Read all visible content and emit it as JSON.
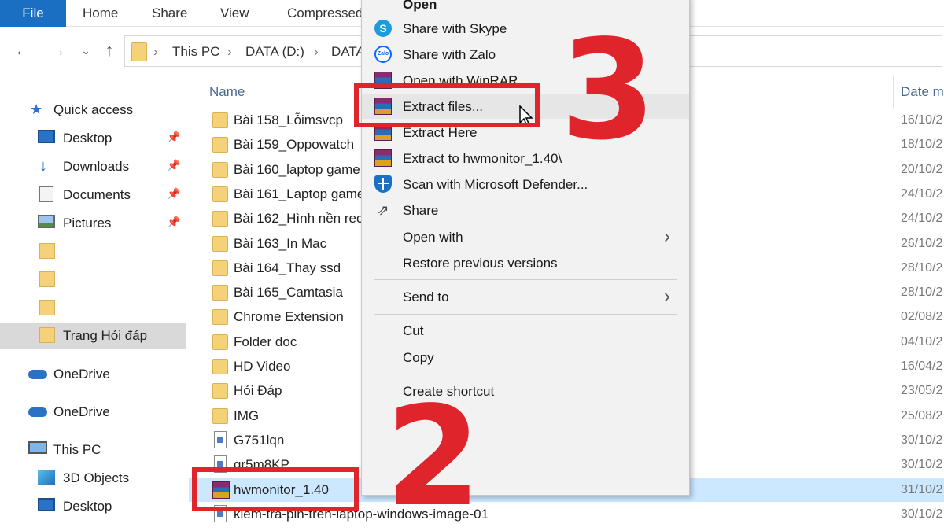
{
  "ribbon": {
    "tabs": [
      "File",
      "Home",
      "Share",
      "View",
      "Compressed"
    ]
  },
  "address": {
    "crumbs": [
      "This PC",
      "DATA (D:)",
      "DATA"
    ]
  },
  "sidebar": {
    "items": [
      {
        "label": "Quick access",
        "icon": "star-icon"
      },
      {
        "label": "Desktop",
        "icon": "desktop-icon",
        "pinned": true
      },
      {
        "label": "Downloads",
        "icon": "download-icon",
        "pinned": true
      },
      {
        "label": "Documents",
        "icon": "documents-icon",
        "pinned": true
      },
      {
        "label": "Pictures",
        "icon": "pictures-icon",
        "pinned": true
      },
      {
        "label": "",
        "icon": "folder-icon"
      },
      {
        "label": "",
        "icon": "folder-icon"
      },
      {
        "label": "",
        "icon": "folder-icon"
      },
      {
        "label": "Trang Hỏi đáp",
        "icon": "folder-icon",
        "selected": true
      },
      {
        "label": "OneDrive",
        "icon": "cloud-icon"
      },
      {
        "label": "OneDrive",
        "icon": "cloud-icon"
      },
      {
        "label": "This PC",
        "icon": "computer-icon"
      },
      {
        "label": "3D Objects",
        "icon": "cube-icon"
      },
      {
        "label": "Desktop",
        "icon": "desktop-icon"
      }
    ]
  },
  "filelist": {
    "columns": {
      "name": "Name",
      "date": "Date m"
    },
    "rows": [
      {
        "name": "Bài 158_Lỗimsvcp",
        "date": "16/10/2",
        "type": "folder"
      },
      {
        "name": "Bài 159_Oppowatch",
        "date": "18/10/2",
        "type": "folder"
      },
      {
        "name": "Bài 160_laptop game",
        "date": "20/10/2",
        "type": "folder"
      },
      {
        "name": "Bài 161_Laptop game",
        "date": "24/10/2",
        "type": "folder"
      },
      {
        "name": "Bài 162_Hình nền rec",
        "date": "24/10/2",
        "type": "folder"
      },
      {
        "name": "Bài 163_In Mac",
        "date": "26/10/2",
        "type": "folder"
      },
      {
        "name": "Bài 164_Thay ssd",
        "date": "28/10/2",
        "type": "folder"
      },
      {
        "name": "Bài 165_Camtasia",
        "date": "28/10/2",
        "type": "folder"
      },
      {
        "name": "Chrome Extension",
        "date": "02/08/2",
        "type": "folder"
      },
      {
        "name": "Folder doc",
        "date": "04/10/2",
        "type": "folder"
      },
      {
        "name": "HD Video",
        "date": "16/04/2",
        "type": "folder"
      },
      {
        "name": "Hỏi Đáp",
        "date": "23/05/2",
        "type": "folder"
      },
      {
        "name": "IMG",
        "date": "25/08/2",
        "type": "folder"
      },
      {
        "name": "G751lqn",
        "date": "30/10/2",
        "type": "file"
      },
      {
        "name": "gr5m8KP",
        "date": "30/10/2",
        "type": "file"
      },
      {
        "name": "hwmonitor_1.40",
        "date": "31/10/2",
        "type": "rar",
        "selected": true
      },
      {
        "name": "kiem-tra-pin-tren-laptop-windows-image-01",
        "date": "30/10/2",
        "type": "file"
      }
    ]
  },
  "context_menu": {
    "items": [
      {
        "label": "Open",
        "icon": ""
      },
      {
        "label": "Share with Skype",
        "icon": "skype-icon"
      },
      {
        "label": "Share with Zalo",
        "icon": "zalo-icon"
      },
      {
        "label": "Open with WinRAR",
        "icon": "winrar-icon"
      },
      {
        "label": "Extract files...",
        "icon": "winrar-icon",
        "highlighted": true
      },
      {
        "label": "Extract Here",
        "icon": "winrar-icon"
      },
      {
        "label": "Extract to hwmonitor_1.40\\",
        "icon": "winrar-icon"
      },
      {
        "label": "Scan with Microsoft Defender...",
        "icon": "defender-shield-icon"
      },
      {
        "label": "Share",
        "icon": "share-icon"
      },
      {
        "label": "Open with",
        "icon": "",
        "submenu": true
      },
      {
        "label": "Restore previous versions",
        "icon": ""
      },
      {
        "label": "Send to",
        "icon": "",
        "submenu": true
      },
      {
        "label": "Cut",
        "icon": ""
      },
      {
        "label": "Copy",
        "icon": ""
      },
      {
        "label": "Create shortcut",
        "icon": ""
      }
    ]
  },
  "annotations": {
    "step_extract": "3",
    "step_file": "2",
    "color": "#e0242c"
  },
  "colors": {
    "accent": "#1a6fc2",
    "selection": "#cce8ff",
    "folder": "#f5d27a"
  }
}
